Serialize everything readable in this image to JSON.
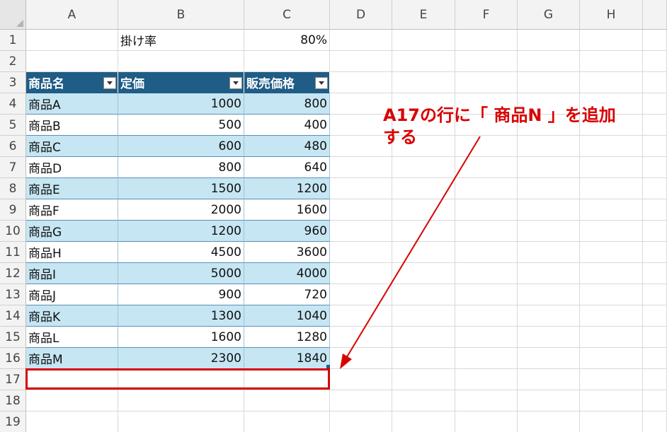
{
  "columns": [
    "A",
    "B",
    "C",
    "D",
    "E",
    "F",
    "G",
    "H"
  ],
  "rows": [
    "1",
    "2",
    "3",
    "4",
    "5",
    "6",
    "7",
    "8",
    "9",
    "10",
    "11",
    "12",
    "13",
    "14",
    "15",
    "16",
    "17",
    "18",
    "19"
  ],
  "header_info": {
    "label": "掛け率",
    "value": "80%"
  },
  "table": {
    "headers": [
      "商品名",
      "定価",
      "販売価格"
    ],
    "data": [
      [
        "商品A",
        "1000",
        "800"
      ],
      [
        "商品B",
        "500",
        "400"
      ],
      [
        "商品C",
        "600",
        "480"
      ],
      [
        "商品D",
        "800",
        "640"
      ],
      [
        "商品E",
        "1500",
        "1200"
      ],
      [
        "商品F",
        "2000",
        "1600"
      ],
      [
        "商品G",
        "1200",
        "960"
      ],
      [
        "商品H",
        "4500",
        "3600"
      ],
      [
        "商品I",
        "5000",
        "4000"
      ],
      [
        "商品J",
        "900",
        "720"
      ],
      [
        "商品K",
        "1300",
        "1040"
      ],
      [
        "商品L",
        "1600",
        "1280"
      ],
      [
        "商品M",
        "2300",
        "1840"
      ]
    ]
  },
  "annotation": {
    "line1": "A17の行に「 商品N 」を追加",
    "line2": "する"
  },
  "colors": {
    "header_fill": "#1f5c86",
    "band_fill": "#c6e6f3",
    "annotation_red": "#d90000"
  }
}
